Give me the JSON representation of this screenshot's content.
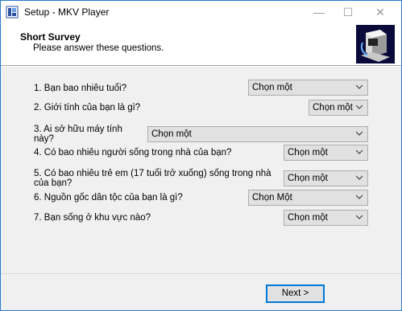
{
  "window": {
    "title": "Setup - MKV Player",
    "minimize_glyph": "—",
    "maximize_glyph": "☐",
    "close_glyph": "✕"
  },
  "header": {
    "title": "Short Survey",
    "subtitle": "Please answer these questions.",
    "image": "computer-box-icon"
  },
  "questions": [
    {
      "label": "1. Bạn bao nhiêu tuổi?",
      "selected": "Chọn một"
    },
    {
      "label": "2. Giới tính của bạn là gì?",
      "selected": "Chọn một"
    },
    {
      "label": "3. Ai sở hữu máy tính này?",
      "line1": "3. Ai sở hữu máy tính",
      "line2": "này?",
      "selected": "Chọn một"
    },
    {
      "label": "4. Có bao nhiêu người sống trong nhà của bạn?",
      "selected": "Chọn một"
    },
    {
      "label": "5. Có bao nhiêu trẻ em (17 tuổi trở xuống) sống trong nhà của bạn?",
      "line1": "5. Có bao nhiêu trẻ em (17 tuổi trở xuống) sống trong nhà",
      "line2": "của bạn?",
      "selected": "Chọn một"
    },
    {
      "label": "6. Nguồn gốc dân tộc của bạn là gì?",
      "selected": "Chọn Một"
    },
    {
      "label": "7. Bạn sống ở khu vực nào?",
      "selected": "Chọn một"
    }
  ],
  "buttons": {
    "next": "Next >"
  }
}
